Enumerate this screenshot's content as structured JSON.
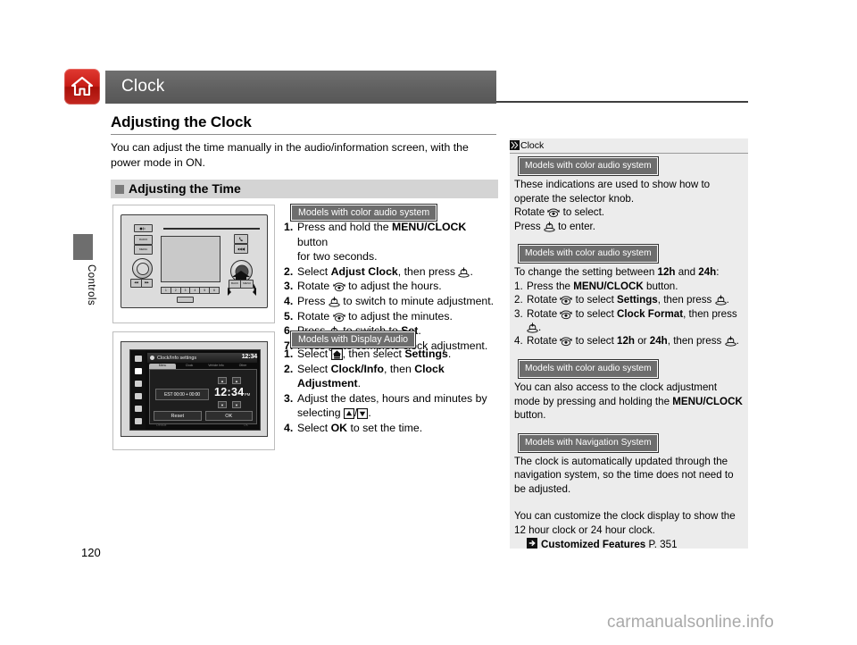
{
  "page": {
    "number": "120",
    "side_tab": "Controls",
    "watermark": "carmanualsonline.info"
  },
  "header": {
    "chapter_title": "Clock",
    "home_icon": "home-icon"
  },
  "main": {
    "h1": "Adjusting the Clock",
    "intro": "You can adjust the time manually in the audio/information screen, with the power mode in ON.",
    "h2": "Adjusting the Time",
    "section_color_audio": {
      "tag": "Models with color audio system",
      "steps": [
        {
          "n": "1.",
          "text": "Press and hold the MENU/CLOCK button for two seconds."
        },
        {
          "n": "2.",
          "text": "Select Adjust Clock, then press (press-knob)."
        },
        {
          "n": "3.",
          "text": "Rotate (rotate-knob) to adjust the hours."
        },
        {
          "n": "4.",
          "text": "Press (press-knob) to switch to minute adjustment."
        },
        {
          "n": "5.",
          "text": "Rotate (rotate-knob) to adjust the minutes."
        },
        {
          "n": "6.",
          "text": "Press (press-knob) to switch to Set."
        },
        {
          "n": "7.",
          "text": "Press (press-knob) to complete clock adjustment."
        }
      ]
    },
    "section_display_audio": {
      "tag": "Models with Display Audio",
      "steps": [
        {
          "n": "1.",
          "text": "Select (home-icon), then select Settings."
        },
        {
          "n": "2.",
          "text": "Select Clock/Info, then Clock Adjustment."
        },
        {
          "n": "3.",
          "text": "Adjust the dates, hours and minutes by selecting (up-arrow)/(down-arrow)."
        },
        {
          "n": "4.",
          "text": "Select OK to set the time."
        }
      ]
    }
  },
  "figure_head_unit": {
    "buttons": {
      "power": "PWR",
      "radio": "RADIO",
      "media": "MEDIA",
      "phone": "phone-icon",
      "track": "track-icon",
      "back": "BACK",
      "menu_clock": "MENU"
    },
    "presets": [
      "1",
      "2",
      "3",
      "4",
      "5",
      "6"
    ]
  },
  "figure_display_audio": {
    "title": "Clock/Info settings",
    "clock": "12:34",
    "tabs": [
      "Menu",
      "Clock",
      "Vehicle Info",
      "Other"
    ],
    "timezone": "EST 00:00 + 00:00",
    "time_hours": "12",
    "time_sep": ":",
    "time_minutes": "34",
    "time_ampm": "PM",
    "buttons": {
      "reset": "Reset",
      "ok": "OK"
    },
    "underbar": {
      "left": "Default",
      "right": "OK"
    }
  },
  "sidebar": {
    "head_glyph": "note-marker-icon",
    "head_title": "Clock",
    "blocks": [
      {
        "tag": "Models with color audio system",
        "lines": [
          "These indications are used to show how to operate the selector knob.",
          "Rotate (rotate-knob) to select.",
          "Press (press-knob) to enter."
        ]
      },
      {
        "tag": "Models with color audio system",
        "lead": "To change the setting between 12h and 24h:",
        "items": [
          {
            "n": "1.",
            "text": "Press the MENU/CLOCK button."
          },
          {
            "n": "2.",
            "text": "Rotate (rotate-knob) to select Settings, then press (press-knob)."
          },
          {
            "n": "3.",
            "text": "Rotate (rotate-knob) to select Clock Format, then press (press-knob)."
          },
          {
            "n": "4.",
            "text": "Rotate (rotate-knob) to select 12h or 24h, then press (press-knob)."
          }
        ]
      },
      {
        "tag": "Models with color audio system",
        "lines": [
          "You can also access to the clock adjustment mode by pressing and holding the MENU/CLOCK button."
        ]
      },
      {
        "tag": "Models with Navigation System",
        "lines": [
          "The clock is automatically updated through the navigation system, so the time does not need to be adjusted.",
          "You can customize the clock display to show the 12 hour clock or 24 hour clock."
        ],
        "xref": {
          "icon": "jump-arrow-icon",
          "label": "Customized Features",
          "page": "P. 351"
        }
      }
    ]
  },
  "colors": {
    "chapter_bar": "#606060",
    "home_badge": "#c81c16",
    "tag_bg": "#6d6d6d",
    "sidebar_bg": "#ececec",
    "h2_bar": "#d4d4d4"
  }
}
